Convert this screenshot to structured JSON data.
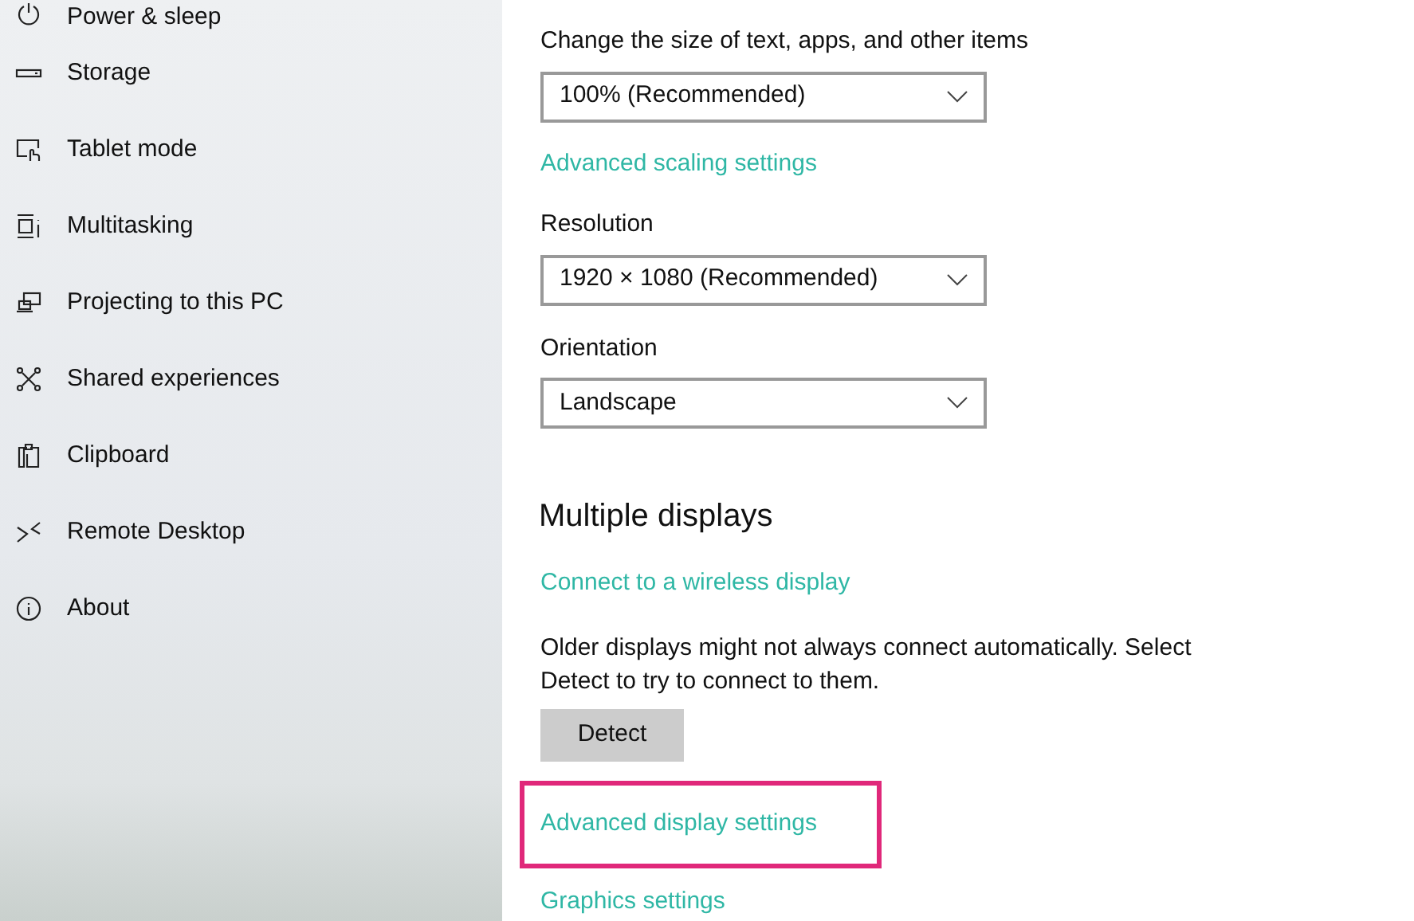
{
  "sidebar": {
    "items": [
      {
        "label": "Power & sleep",
        "kind": "power"
      },
      {
        "label": "Storage",
        "kind": "storage"
      },
      {
        "label": "Tablet mode",
        "kind": "tablet"
      },
      {
        "label": "Multitasking",
        "kind": "multitasking"
      },
      {
        "label": "Projecting to this PC",
        "kind": "projecting"
      },
      {
        "label": "Shared experiences",
        "kind": "shared"
      },
      {
        "label": "Clipboard",
        "kind": "clipboard"
      },
      {
        "label": "Remote Desktop",
        "kind": "remote"
      },
      {
        "label": "About",
        "kind": "about"
      }
    ]
  },
  "content": [
    {
      "kind": "label",
      "text": "Change the size of text, apps, and other items"
    },
    {
      "kind": "dropdown",
      "value": "100% (Recommended)"
    },
    {
      "kind": "link",
      "text": "Advanced scaling settings",
      "highlighted": false
    },
    {
      "kind": "label",
      "text": "Resolution"
    },
    {
      "kind": "dropdown",
      "value": "1920 × 1080 (Recommended)"
    },
    {
      "kind": "label",
      "text": "Orientation"
    },
    {
      "kind": "dropdown",
      "value": "Landscape"
    },
    {
      "kind": "heading",
      "text": "Multiple displays"
    },
    {
      "kind": "link",
      "text": "Connect to a wireless display",
      "highlighted": false
    },
    {
      "kind": "paragraph",
      "text": "Older displays might not always connect automatically. Select Detect to try to connect to them."
    },
    {
      "kind": "button",
      "text": "Detect"
    },
    {
      "kind": "link",
      "text": "Advanced display settings",
      "highlighted": true
    },
    {
      "kind": "link",
      "text": "Graphics settings",
      "highlighted": false
    }
  ]
}
